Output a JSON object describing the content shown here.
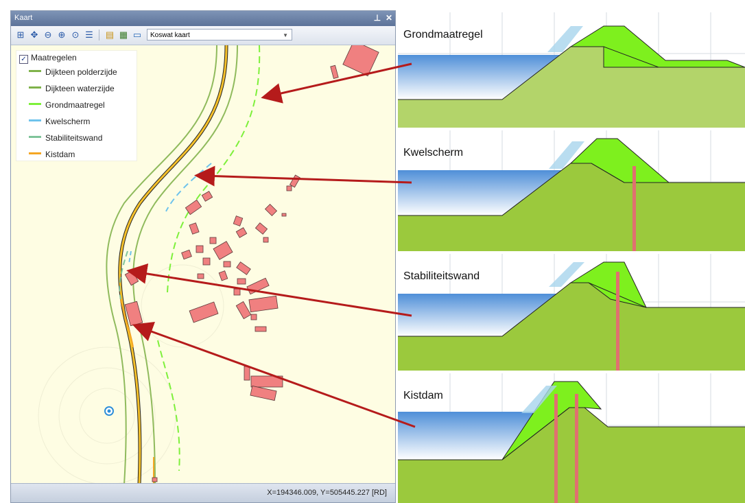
{
  "map_window": {
    "title": "Kaart",
    "pin_icon": "pin-icon",
    "close_icon": "close-icon",
    "toolbar": {
      "tools": [
        "zoom-extent-icon",
        "pan-icon",
        "zoom-out-icon",
        "zoom-in-icon",
        "zoom-window-icon",
        "legend-list-icon",
        "layer-add-icon",
        "layer-edit-icon",
        "layer-image-icon"
      ],
      "layer_select_value": "Koswat kaart"
    },
    "legend": {
      "group_label": "Maatregelen",
      "group_checked": true,
      "items": [
        {
          "label": "Dijkteen polderzijde",
          "color": "#7fb24a"
        },
        {
          "label": "Dijkteen waterzijde",
          "color": "#7fb24a"
        },
        {
          "label": "Grondmaatregel",
          "color": "#7df03a"
        },
        {
          "label": "Kwelscherm",
          "color": "#6ec3ec"
        },
        {
          "label": "Stabiliteitswand",
          "color": "#7fc49a"
        },
        {
          "label": "Kistdam",
          "color": "#f5a623"
        }
      ]
    },
    "status": "X=194346.009, Y=505445.227 [RD]"
  },
  "profiles": [
    {
      "label": "Grondmaatregel"
    },
    {
      "label": "Kwelscherm"
    },
    {
      "label": "Stabiliteitswand"
    },
    {
      "label": "Kistdam"
    }
  ],
  "colors": {
    "dike_green": "#9bc93d",
    "measure_green": "#7ef01e",
    "water_blue": "#4f8fd8",
    "arrow_red": "#b51b1b",
    "building": "#f07f7f"
  }
}
